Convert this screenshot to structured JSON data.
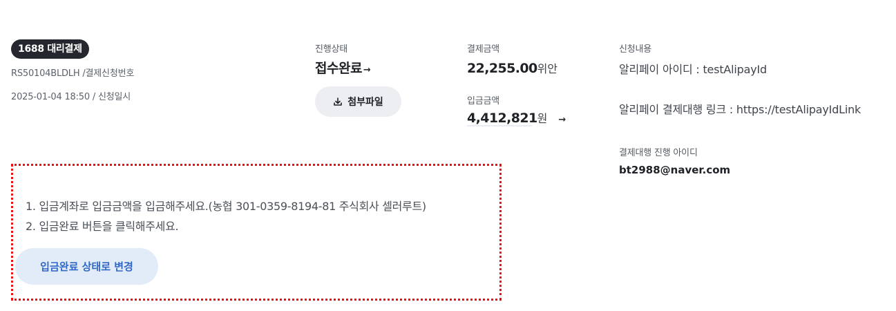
{
  "order": {
    "badge": "1688 대리결제",
    "request_number": "RS50104BLDLH /결제신청번호",
    "request_date": "2025-01-04 18:50 / 신청일시"
  },
  "status": {
    "label": "진행상태",
    "value": "접수완료",
    "arrow": "→",
    "attach_button": "첨부파일"
  },
  "payment": {
    "label": "결제금액",
    "amount": "22,255.00",
    "unit": "위안"
  },
  "deposit": {
    "label": "입금금액",
    "amount": "4,412,821",
    "unit": "원",
    "arrow": "→"
  },
  "details": {
    "label": "신청내용",
    "alipay_id": "알리페이 아이디 : testAlipayId",
    "alipay_link": "알리페이 결제대행 링크 : https://testAlipayIdLink",
    "agent_label": "결제대행 진행 아이디",
    "agent_id": "bt2988@naver.com"
  },
  "instructions": {
    "line1": "1. 입금계좌로 입금금액을 입금해주세요.(농협 301-0359-8194-81 주식회사 셀러루트)",
    "line2": "2. 입금완료 버튼을 클릭해주세요.",
    "button": "입금완료 상태로 변경"
  },
  "colors": {
    "badge_bg": "#24272d",
    "highlight_border": "#ee1010",
    "primary_button_bg": "#e2ebf8",
    "primary_button_text": "#3168c6",
    "secondary_button_bg": "#eceef2"
  },
  "icons": {
    "attach": "download-icon",
    "status_arrow": "arrow-right-icon",
    "deposit_arrow": "arrow-right-icon"
  }
}
